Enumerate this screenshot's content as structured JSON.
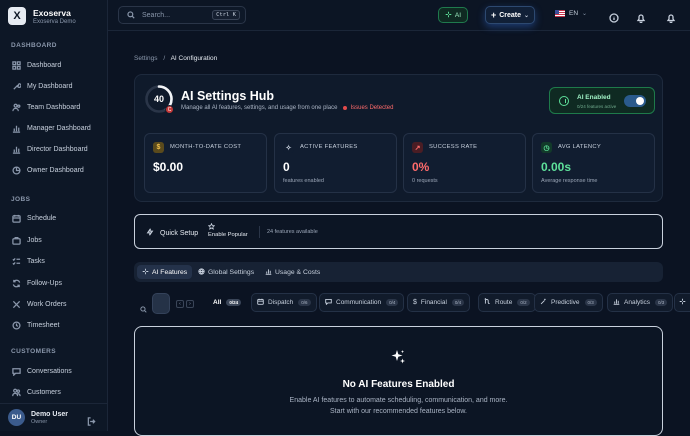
{
  "brand": {
    "name": "Exoserva",
    "subtitle": "Exoserva Demo",
    "logo": "X"
  },
  "sidebar": {
    "sections": [
      {
        "title": "DASHBOARD",
        "items": [
          {
            "label": "Dashboard",
            "icon": "grid-icon"
          },
          {
            "label": "My Dashboard",
            "icon": "wrench-icon"
          },
          {
            "label": "Team Dashboard",
            "icon": "users-icon"
          },
          {
            "label": "Manager Dashboard",
            "icon": "bar-chart-icon"
          },
          {
            "label": "Director Dashboard",
            "icon": "bar-chart-icon"
          },
          {
            "label": "Owner Dashboard",
            "icon": "pie-chart-icon"
          }
        ]
      },
      {
        "title": "JOBS",
        "items": [
          {
            "label": "Schedule",
            "icon": "calendar-icon"
          },
          {
            "label": "Jobs",
            "icon": "briefcase-icon"
          },
          {
            "label": "Tasks",
            "icon": "checklist-icon"
          },
          {
            "label": "Follow-Ups",
            "icon": "refresh-icon"
          },
          {
            "label": "Work Orders",
            "icon": "tools-icon"
          },
          {
            "label": "Timesheet",
            "icon": "clock-icon"
          }
        ]
      },
      {
        "title": "CUSTOMERS",
        "items": [
          {
            "label": "Conversations",
            "icon": "chat-icon"
          },
          {
            "label": "Customers",
            "icon": "user-group-icon"
          }
        ]
      }
    ],
    "user": {
      "initials": "DU",
      "name": "Demo User",
      "role": "Owner"
    }
  },
  "topbar": {
    "search_placeholder": "Search...",
    "search_shortcut": "Ctrl K",
    "ai_label": "AI",
    "create_label": "Create",
    "language": "EN"
  },
  "breadcrumb": {
    "parent": "Settings",
    "separator": "/",
    "current": "AI Configuration"
  },
  "hub": {
    "score": "40",
    "score_badge": "C",
    "score_fraction": 0.4,
    "title": "AI Settings Hub",
    "subtitle": "Manage all AI features, settings, and usage from one place",
    "issues": "Issues Detected",
    "ai_status": {
      "title": "AI Enabled",
      "subtitle": "0/24 features active",
      "enabled": true
    },
    "stats": [
      {
        "icon": "dollar-icon",
        "label": "MONTH-TO-DATE COST",
        "value": "$0.00",
        "caption": "",
        "color": "#ffffff",
        "icon_bg": "#5a4a1c",
        "icon_fg": "#f2c14e"
      },
      {
        "icon": "sparkle-icon",
        "label": "ACTIVE FEATURES",
        "value": "0",
        "caption": "features enabled",
        "color": "#ffffff",
        "icon_bg": "#111d30",
        "icon_fg": "#c7d0dd"
      },
      {
        "icon": "trend-icon",
        "label": "SUCCESS RATE",
        "value": "0%",
        "caption": "0 requests",
        "color": "#ff6b6b",
        "icon_bg": "#4a1d24",
        "icon_fg": "#ff6b6b"
      },
      {
        "icon": "clock-icon",
        "label": "AVG LATENCY",
        "value": "0.00s",
        "caption": "Average response time",
        "color": "#5ee09a",
        "icon_bg": "#123a2a",
        "icon_fg": "#5ee09a"
      }
    ]
  },
  "quick_setup": {
    "label": "Quick Setup",
    "enable_popular": "Enable Popular",
    "features_available": "24 features available"
  },
  "tabs": [
    {
      "label": "AI Features",
      "icon": "sparkle-icon",
      "active": true
    },
    {
      "label": "Global Settings",
      "icon": "globe-icon",
      "active": false
    },
    {
      "label": "Usage & Costs",
      "icon": "bar-chart-icon",
      "active": false
    }
  ],
  "filters": [
    {
      "label": "All",
      "count": "0/24",
      "icon": ""
    },
    {
      "label": "Dispatch",
      "count": "0/6",
      "icon": "calendar-icon"
    },
    {
      "label": "Communication",
      "count": "0/4",
      "icon": "chat-icon"
    },
    {
      "label": "Financial",
      "count": "0/4",
      "icon": "dollar-icon"
    },
    {
      "label": "Route",
      "count": "0/2",
      "icon": "route-icon"
    },
    {
      "label": "Predictive",
      "count": "0/3",
      "icon": "wand-icon"
    },
    {
      "label": "Analytics",
      "count": "0/3",
      "icon": "bar-chart-icon"
    }
  ],
  "empty_state": {
    "title": "No AI Features Enabled",
    "description": "Enable AI features to automate scheduling, communication, and more. Start with our recommended features below."
  },
  "colors": {
    "accent": "#5ee09a",
    "danger": "#e24b4b",
    "brand_blue": "#3b82f6",
    "background": "#0b1322"
  }
}
